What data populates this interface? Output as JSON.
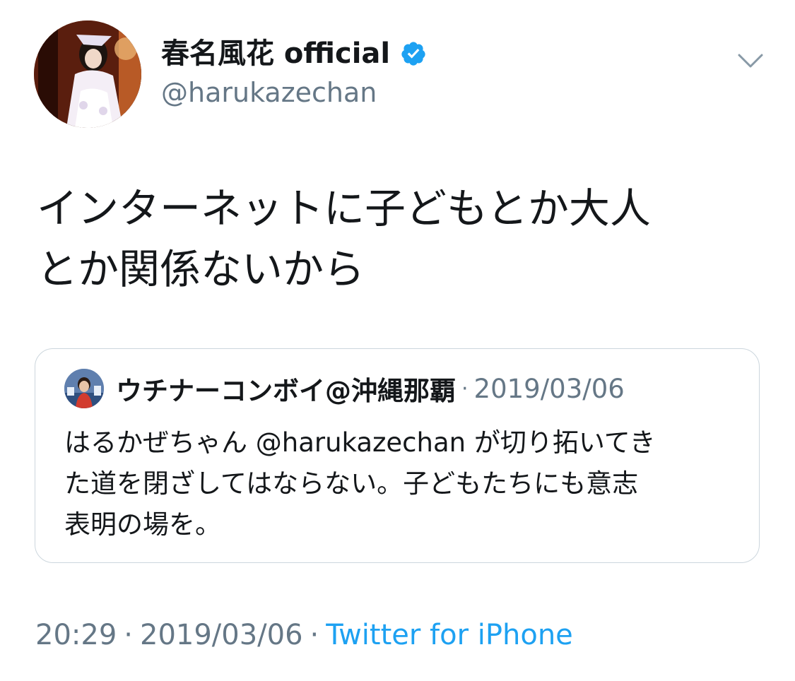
{
  "tweet": {
    "display_name": "春名風花 official",
    "handle": "@harukazechan",
    "verified": true,
    "text": "インターネットに子どもとか大人\nとか関係ないから",
    "time": "20:29",
    "date": "2019/03/06",
    "source": "Twitter for iPhone",
    "separator": "·"
  },
  "quoted": {
    "display_name": "ウチナーコンボイ@沖縄那覇",
    "separator": "·",
    "date": "2019/03/06",
    "text": "はるかぜちゃん @harukazechan が切り拓いてき\nた道を閉ざしてはならない。子どもたちにも意志\n表明の場を。"
  },
  "icons": {
    "verified": "verified-badge-icon",
    "menu": "chevron-down-icon"
  },
  "colors": {
    "text": "#14171a",
    "secondary": "#657786",
    "link": "#1da1f2",
    "verified": "#1da1f2",
    "border": "#ccd6dd"
  }
}
